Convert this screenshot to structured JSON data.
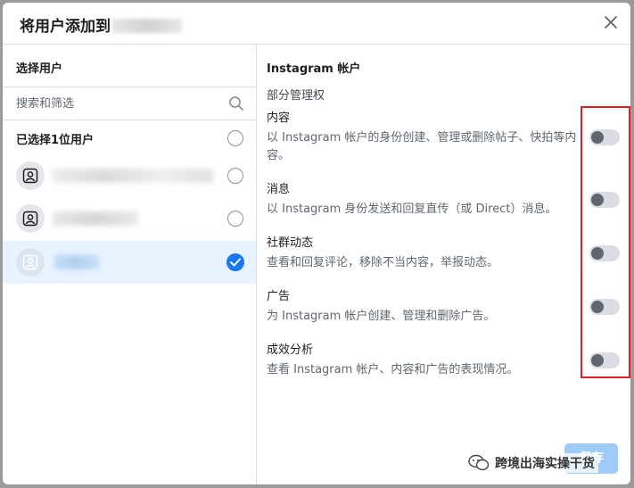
{
  "modal": {
    "title": "将用户添加到",
    "close_icon": "close-icon"
  },
  "left": {
    "heading": "选择用户",
    "search_placeholder": "搜索和筛选",
    "selected_count": "已选择1位用户",
    "users": [
      {
        "selected": false
      },
      {
        "selected": false
      },
      {
        "selected": true
      }
    ]
  },
  "right": {
    "account_title": "Instagram 帐户",
    "permission_level": "部分管理权",
    "permissions": [
      {
        "title": "内容",
        "description": "以 Instagram 帐户的身份创建、管理或删除帖子、快拍等内容。",
        "enabled": false
      },
      {
        "title": "消息",
        "description": "以 Instagram 身份发送和回复直传（或 Direct）消息。",
        "enabled": false
      },
      {
        "title": "社群动态",
        "description": "查看和回复评论，移除不当内容，举报动态。",
        "enabled": false
      },
      {
        "title": "广告",
        "description": "为 Instagram 帐户创建、管理和删除广告。",
        "enabled": false
      },
      {
        "title": "成效分析",
        "description": "查看 Instagram 帐户、内容和广告的表现情况。",
        "enabled": false
      }
    ]
  },
  "footer": {
    "primary_label": "保存"
  },
  "watermark": {
    "text": "跨境出海实操干货"
  },
  "colors": {
    "accent": "#1877f2",
    "highlight": "#e02020",
    "toggle_off": "#dadde1"
  }
}
